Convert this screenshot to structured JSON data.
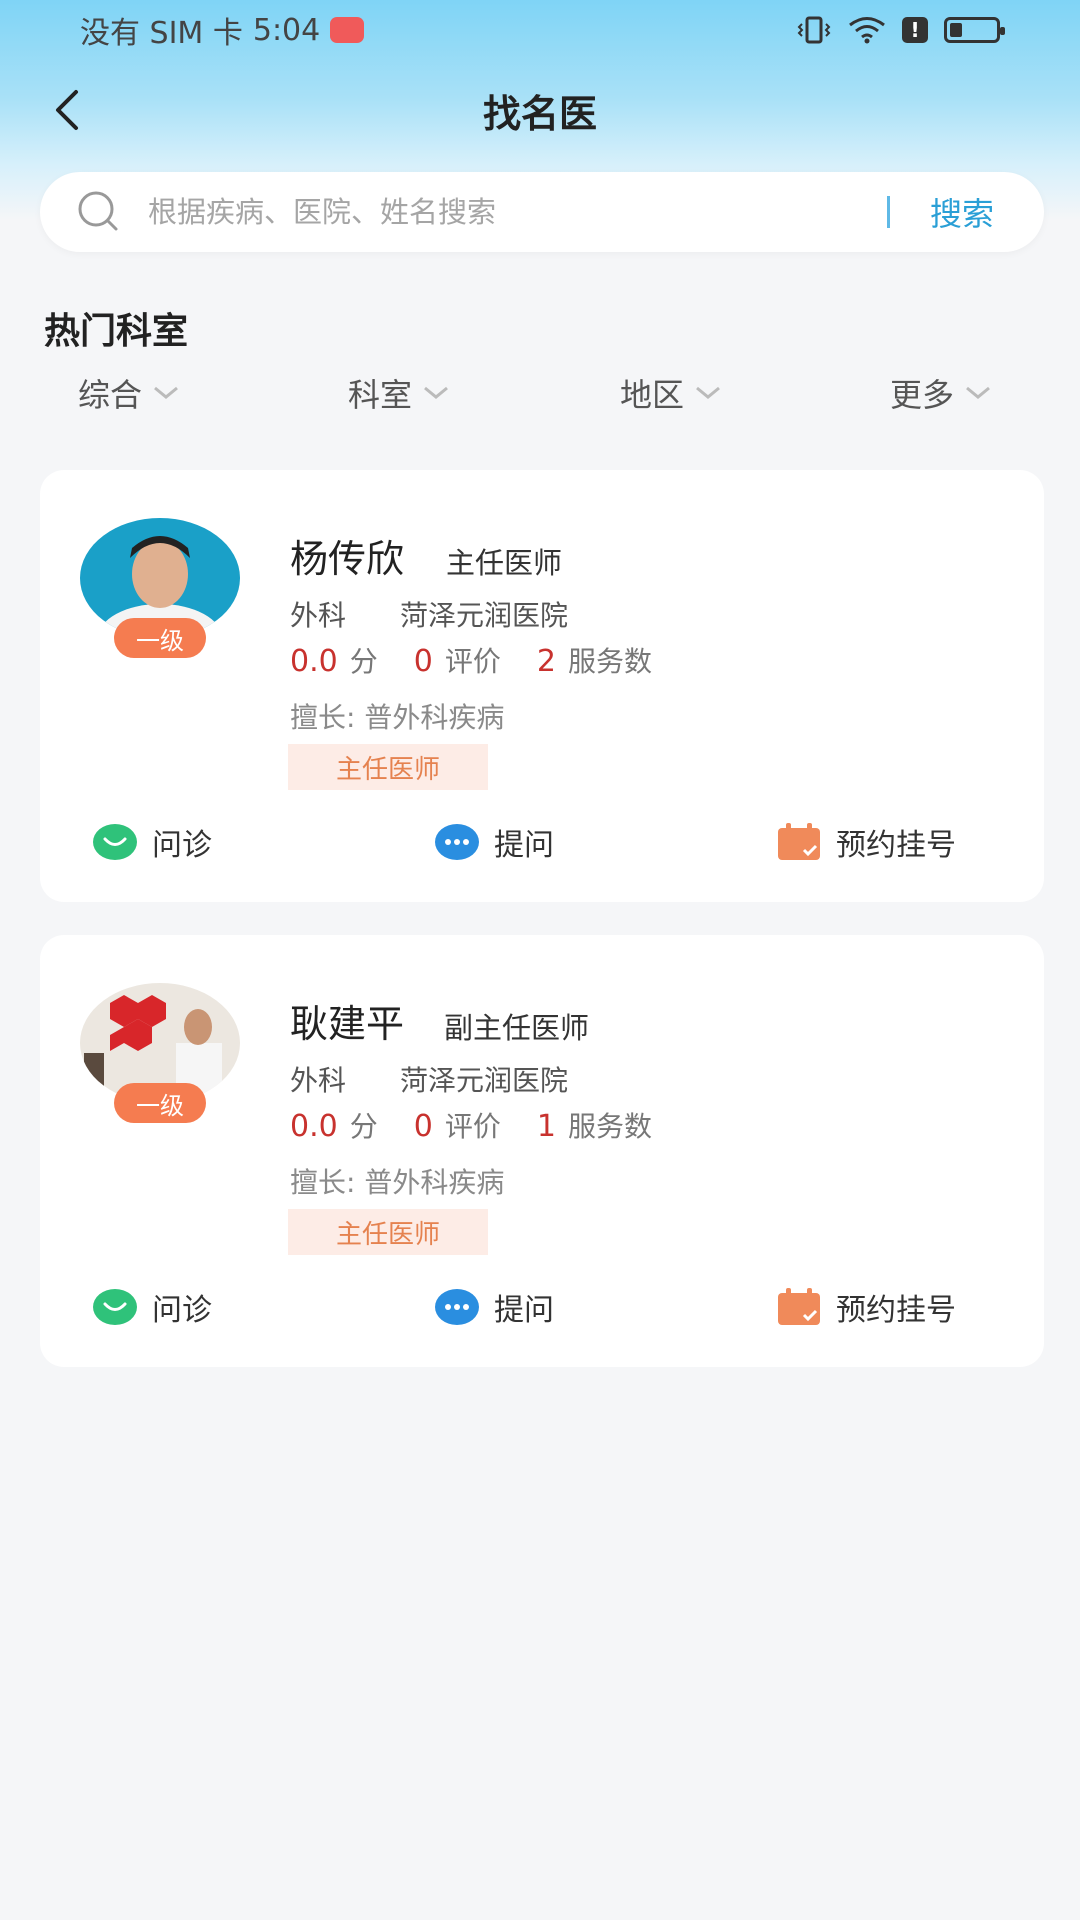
{
  "status_bar": {
    "carrier": "没有 SIM 卡",
    "time": "5:04",
    "alert": "!"
  },
  "nav": {
    "title": "找名医",
    "back_icon": "chevron-left-icon"
  },
  "search": {
    "placeholder": "根据疾病、医院、姓名搜索",
    "button": "搜索"
  },
  "section": {
    "title": "热门科室"
  },
  "filters": [
    {
      "label": "综合"
    },
    {
      "label": "科室"
    },
    {
      "label": "地区"
    },
    {
      "label": "更多"
    }
  ],
  "doctors": [
    {
      "name": "杨传欣",
      "title": "主任医师",
      "level": "一级",
      "dept": "外科",
      "hospital": "菏泽元润医院",
      "score": "0.0",
      "score_unit": "分",
      "reviews": "0",
      "reviews_unit": "评价",
      "services": "2",
      "services_unit": "服务数",
      "specialty": "擅长:  普外科疾病",
      "tag": "主任医师",
      "actions": {
        "consult": "问诊",
        "ask": "提问",
        "appointment": "预约挂号"
      }
    },
    {
      "name": "耿建平",
      "title": "副主任医师",
      "level": "一级",
      "dept": "外科",
      "hospital": "菏泽元润医院",
      "score": "0.0",
      "score_unit": "分",
      "reviews": "0",
      "reviews_unit": "评价",
      "services": "1",
      "services_unit": "服务数",
      "specialty": "擅长:  普外科疾病",
      "tag": "主任医师",
      "actions": {
        "consult": "问诊",
        "ask": "提问",
        "appointment": "预约挂号"
      }
    }
  ],
  "colors": {
    "accent": "#2a9fd6",
    "stat_number": "#c8322e",
    "level_badge": "#f57c50",
    "tag_bg": "#fdece6",
    "tag_text": "#e5824f"
  }
}
